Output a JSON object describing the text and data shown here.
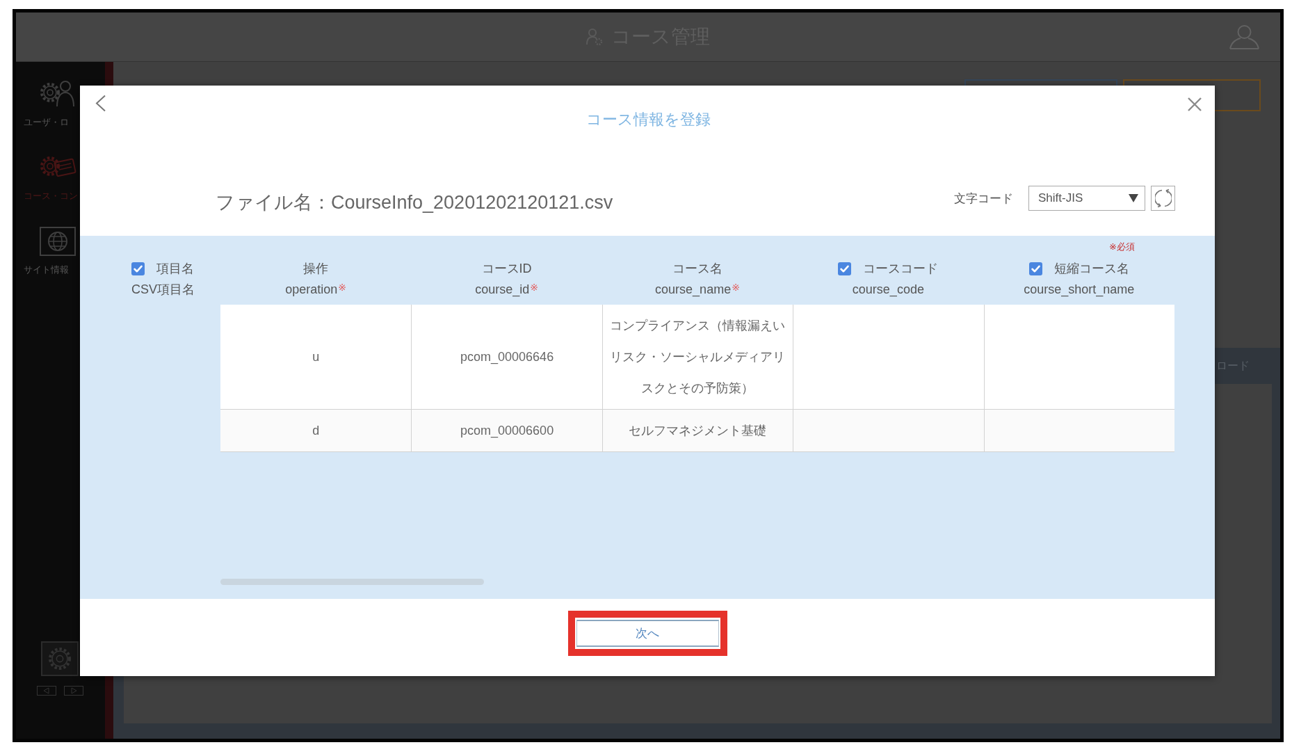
{
  "background_app": {
    "header": {
      "title": "コース管理"
    },
    "sidebar": {
      "items": [
        {
          "kind": "user",
          "label": "ユーザ・ロ",
          "selected": false
        },
        {
          "kind": "course",
          "label": "コース・コン",
          "selected": true
        },
        {
          "kind": "site",
          "label": "サイト情報",
          "selected": false
        }
      ]
    },
    "section_bar": {
      "label": "ロード"
    }
  },
  "dialog": {
    "title": "コース情報を登録",
    "file_name": "ファイル名：CourseInfo_20201202120121.csv",
    "encoding": {
      "label": "文字コード",
      "value": "Shift-JIS"
    },
    "required_note": "※必須",
    "header_labels": {
      "checked": true,
      "name_label": "項目名",
      "csv_label": "CSV項目名"
    },
    "columns": [
      {
        "kind": "required",
        "name": "操作",
        "csv_name": "operation",
        "required_mark": "※"
      },
      {
        "kind": "required",
        "name": "コースID",
        "csv_name": "course_id",
        "required_mark": "※"
      },
      {
        "kind": "required",
        "name": "コース名",
        "csv_name": "course_name",
        "required_mark": "※"
      },
      {
        "kind": "optional",
        "name": "コースコード",
        "csv_name": "course_code",
        "checked": true
      },
      {
        "kind": "optional",
        "name": "短縮コース名",
        "csv_name": "course_short_name",
        "checked": true
      }
    ],
    "rows": [
      {
        "cells": [
          "u",
          "pcom_00006646",
          "コンプライアンス（情報漏えいリスク・ソーシャルメディアリスクとその予防策）"
        ]
      },
      {
        "cells": [
          "d",
          "pcom_00006600",
          "セルフマネジメント基礎"
        ]
      }
    ],
    "next_button": {
      "label": "次へ",
      "highlighted": true
    }
  }
}
